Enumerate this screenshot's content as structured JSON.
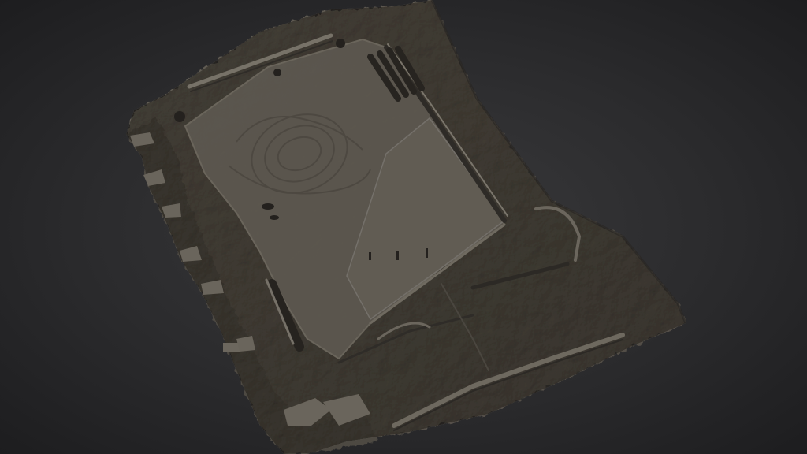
{
  "viewer": {
    "background_color": "#2e2e30",
    "model_color": "#59544c",
    "model_highlight": "#6e6a61",
    "model_shadow": "#2a2724"
  }
}
